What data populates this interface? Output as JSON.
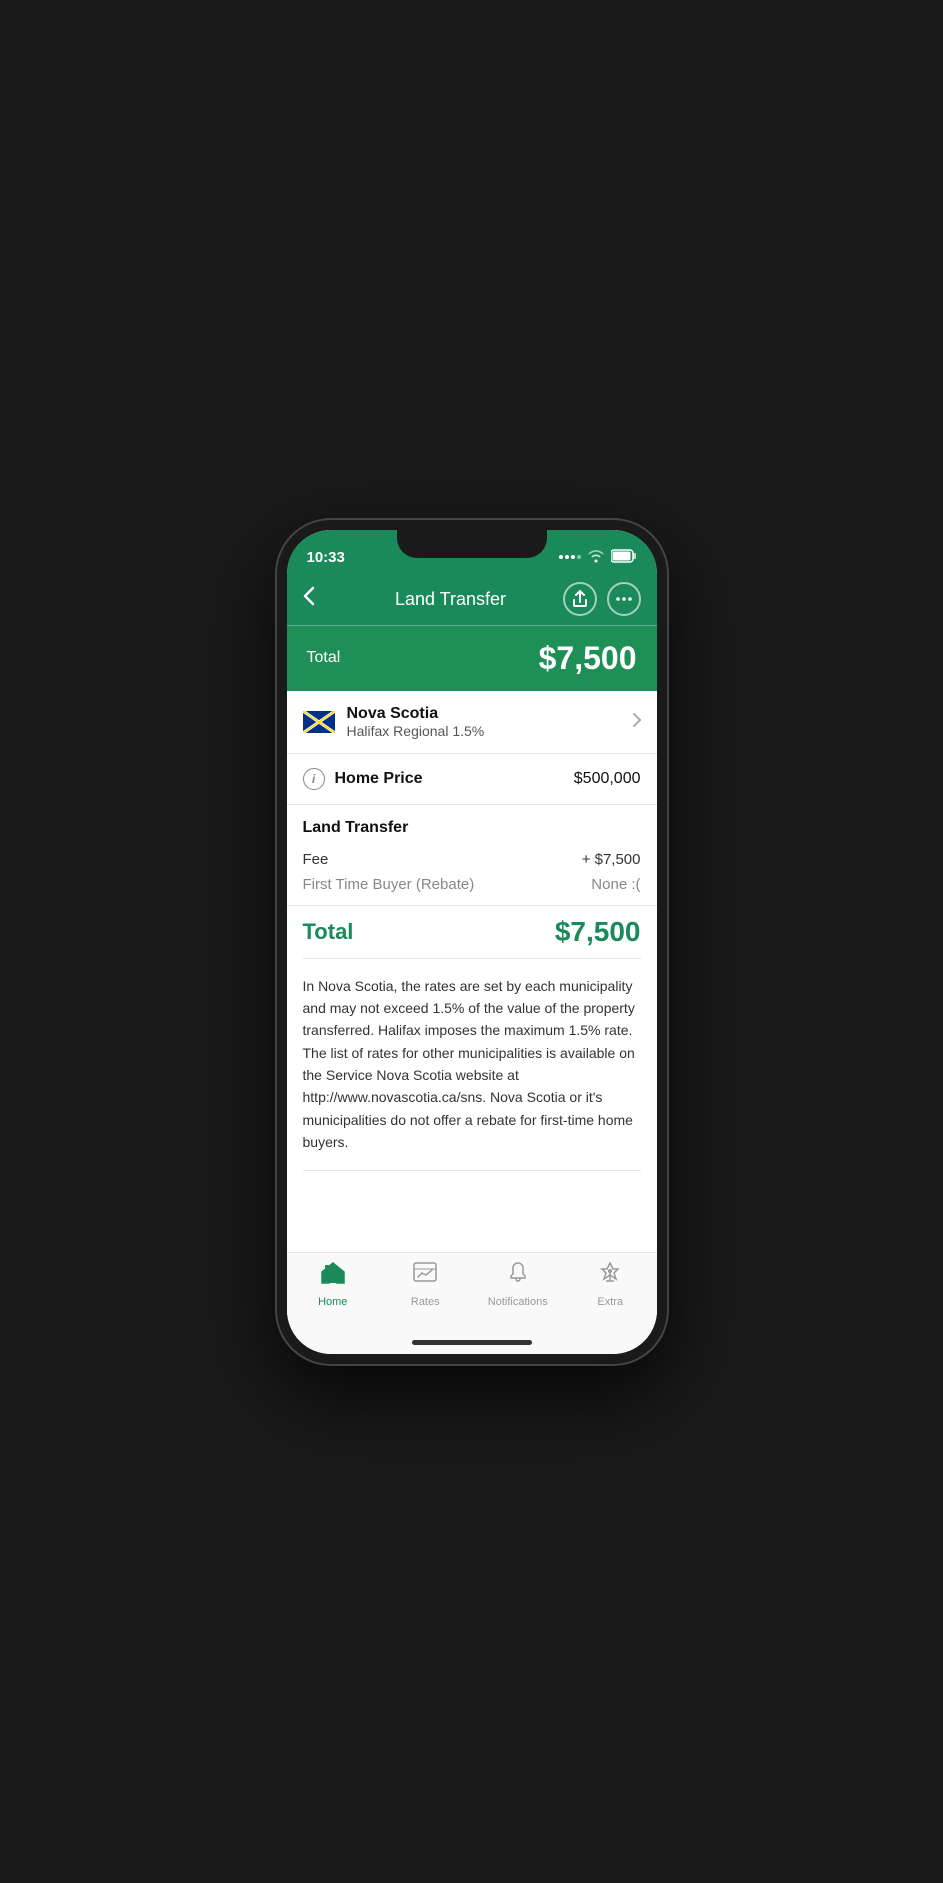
{
  "statusBar": {
    "time": "10:33"
  },
  "navBar": {
    "title": "Land Transfer",
    "backLabel": "<",
    "shareIcon": "↑",
    "moreIcon": "•••"
  },
  "totalBanner": {
    "label": "Total",
    "amount": "$7,500"
  },
  "province": {
    "name": "Nova Scotia",
    "subtitle": "Halifax Regional 1.5%"
  },
  "homePrice": {
    "label": "Home Price",
    "value": "$500,000",
    "infoIcon": "i"
  },
  "landTransfer": {
    "sectionTitle": "Land Transfer",
    "feeLabel": "Fee",
    "feeValue": "+ $7,500",
    "rebateLabel": "First Time Buyer (Rebate)",
    "rebateValue": "None :(",
    "totalLabel": "Total",
    "totalValue": "$7,500"
  },
  "description": "In Nova Scotia, the rates are set by each municipality and may not exceed 1.5% of the value of the property transferred. Halifax imposes the maximum 1.5% rate. The list of rates for other municipalities is available on the Service Nova Scotia website at http://www.novascotia.ca/sns. Nova Scotia or it's municipalities do not offer a rebate for first-time home buyers.",
  "tabBar": {
    "items": [
      {
        "id": "home",
        "label": "Home",
        "icon": "🏠",
        "active": true
      },
      {
        "id": "rates",
        "label": "Rates",
        "icon": "📊",
        "active": false
      },
      {
        "id": "notifications",
        "label": "Notifications",
        "icon": "🔔",
        "active": false
      },
      {
        "id": "extra",
        "label": "Extra",
        "icon": "🚀",
        "active": false
      }
    ]
  }
}
